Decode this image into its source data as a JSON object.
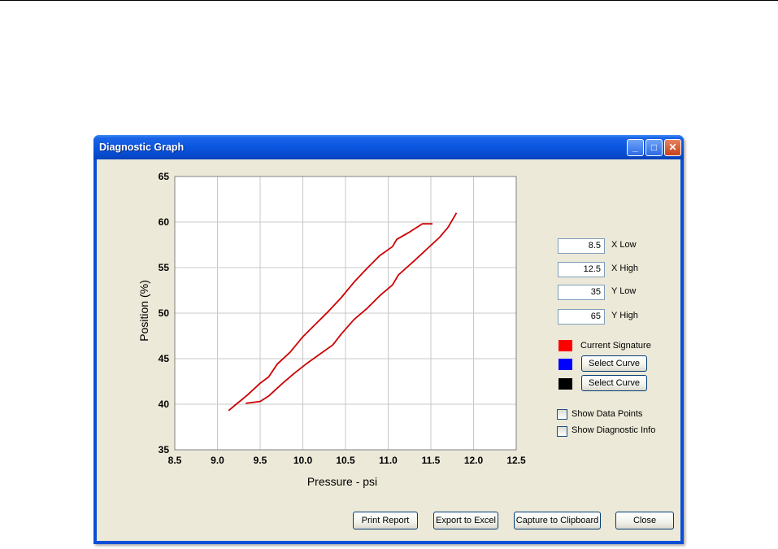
{
  "window": {
    "title": "Diagnostic Graph"
  },
  "title_buttons": {
    "minimize": "_",
    "maximize": "□",
    "close": "✕"
  },
  "chart_data": {
    "type": "line",
    "xlabel": "Pressure - psi",
    "ylabel": "Position (%)",
    "xlim": [
      8.5,
      12.5
    ],
    "ylim": [
      35,
      65
    ],
    "x_ticks": [
      "8.5",
      "9.0",
      "9.5",
      "10.0",
      "10.5",
      "11.0",
      "11.5",
      "12.0",
      "12.5"
    ],
    "y_ticks": [
      "35",
      "40",
      "45",
      "50",
      "55",
      "60",
      "65"
    ],
    "grid": true,
    "series": [
      {
        "color": "#cc0000",
        "points": [
          [
            9.13,
            39.3
          ],
          [
            9.22,
            40.0
          ],
          [
            9.35,
            41.0
          ],
          [
            9.5,
            42.3
          ],
          [
            9.6,
            43.0
          ],
          [
            9.7,
            44.4
          ],
          [
            9.85,
            45.7
          ],
          [
            10.0,
            47.4
          ],
          [
            10.15,
            48.8
          ],
          [
            10.3,
            50.2
          ],
          [
            10.45,
            51.7
          ],
          [
            10.6,
            53.4
          ],
          [
            10.75,
            54.9
          ],
          [
            10.9,
            56.3
          ],
          [
            11.05,
            57.3
          ],
          [
            11.1,
            58.1
          ],
          [
            11.25,
            58.9
          ],
          [
            11.4,
            59.8
          ],
          [
            11.52,
            59.8
          ]
        ]
      },
      {
        "color": "#cc0000",
        "points": [
          [
            9.33,
            40.1
          ],
          [
            9.5,
            40.3
          ],
          [
            9.6,
            40.9
          ],
          [
            9.75,
            42.2
          ],
          [
            9.9,
            43.4
          ],
          [
            10.05,
            44.5
          ],
          [
            10.2,
            45.5
          ],
          [
            10.35,
            46.5
          ],
          [
            10.45,
            47.7
          ],
          [
            10.6,
            49.3
          ],
          [
            10.75,
            50.5
          ],
          [
            10.9,
            51.9
          ],
          [
            11.05,
            53.1
          ],
          [
            11.12,
            54.2
          ],
          [
            11.3,
            55.7
          ],
          [
            11.45,
            57.0
          ],
          [
            11.6,
            58.3
          ],
          [
            11.7,
            59.4
          ],
          [
            11.8,
            61.0
          ]
        ]
      }
    ]
  },
  "range": {
    "x_low": {
      "value": "8.5",
      "label": "X Low"
    },
    "x_high": {
      "value": "12.5",
      "label": "X High"
    },
    "y_low": {
      "value": "35",
      "label": "Y Low"
    },
    "y_high": {
      "value": "65",
      "label": "Y High"
    }
  },
  "legend": {
    "current": {
      "label": "Current Signature",
      "color": "#ff0000"
    },
    "blue": {
      "button": "Select Curve",
      "color": "#0000ff"
    },
    "black": {
      "button": "Select Curve",
      "color": "#000000"
    }
  },
  "options": {
    "show_data_points": {
      "label": "Show Data Points",
      "checked": false
    },
    "show_diagnostic_info": {
      "label": "Show Diagnostic Info",
      "checked": false
    }
  },
  "buttons": {
    "print": "Print Report",
    "export": "Export to Excel",
    "capture": "Capture to Clipboard",
    "close": "Close"
  }
}
